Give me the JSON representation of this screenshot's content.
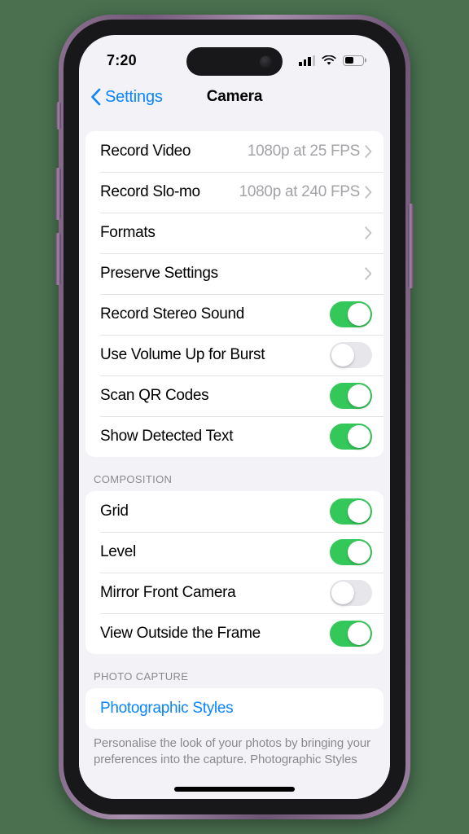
{
  "status_bar": {
    "time": "7:20",
    "cellular_icon": "cellular-signal-icon",
    "wifi_icon": "wifi-icon",
    "battery_icon": "battery-icon"
  },
  "nav": {
    "back_label": "Settings",
    "back_icon": "chevron-left-icon",
    "title": "Camera"
  },
  "colors": {
    "accent_blue": "#0a84ff",
    "toggle_on_green": "#34c759",
    "toggle_off_gray": "#e6e6eb",
    "background": "#f2f2f7",
    "frame_purple": "#8b6f8e"
  },
  "sections": [
    {
      "header": "",
      "rows": [
        {
          "label": "Record Video",
          "type": "disclosure",
          "value": "1080p at 25 FPS"
        },
        {
          "label": "Record Slo-mo",
          "type": "disclosure",
          "value": "1080p at 240 FPS"
        },
        {
          "label": "Formats",
          "type": "disclosure",
          "value": ""
        },
        {
          "label": "Preserve Settings",
          "type": "disclosure",
          "value": ""
        },
        {
          "label": "Record Stereo Sound",
          "type": "toggle",
          "on": true
        },
        {
          "label": "Use Volume Up for Burst",
          "type": "toggle",
          "on": false
        },
        {
          "label": "Scan QR Codes",
          "type": "toggle",
          "on": true
        },
        {
          "label": "Show Detected Text",
          "type": "toggle",
          "on": true
        }
      ]
    },
    {
      "header": "COMPOSITION",
      "rows": [
        {
          "label": "Grid",
          "type": "toggle",
          "on": true
        },
        {
          "label": "Level",
          "type": "toggle",
          "on": true
        },
        {
          "label": "Mirror Front Camera",
          "type": "toggle",
          "on": false
        },
        {
          "label": "View Outside the Frame",
          "type": "toggle",
          "on": true
        }
      ]
    },
    {
      "header": "PHOTO CAPTURE",
      "rows": [
        {
          "label": "Photographic Styles",
          "type": "link"
        }
      ],
      "footer": "Personalise the look of your photos by bringing your preferences into the capture. Photographic Styles"
    }
  ]
}
